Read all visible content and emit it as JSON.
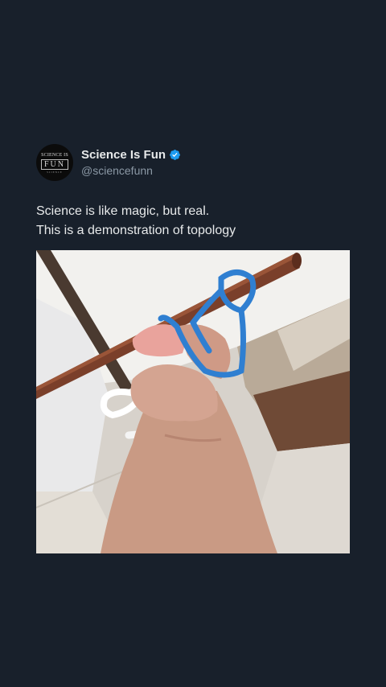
{
  "post": {
    "display_name": "Science Is Fun",
    "handle": "@sciencefunn",
    "verified_icon": "verified-badge-icon",
    "verified_color": "#1d9bf0",
    "text_lines": [
      "Science is like magic, but real.",
      "This is a demonstration of topology"
    ],
    "avatar": {
      "top_text": "SCIENCE IS",
      "middle_text": "FUN",
      "bottom_text": "SCIENCE"
    }
  }
}
